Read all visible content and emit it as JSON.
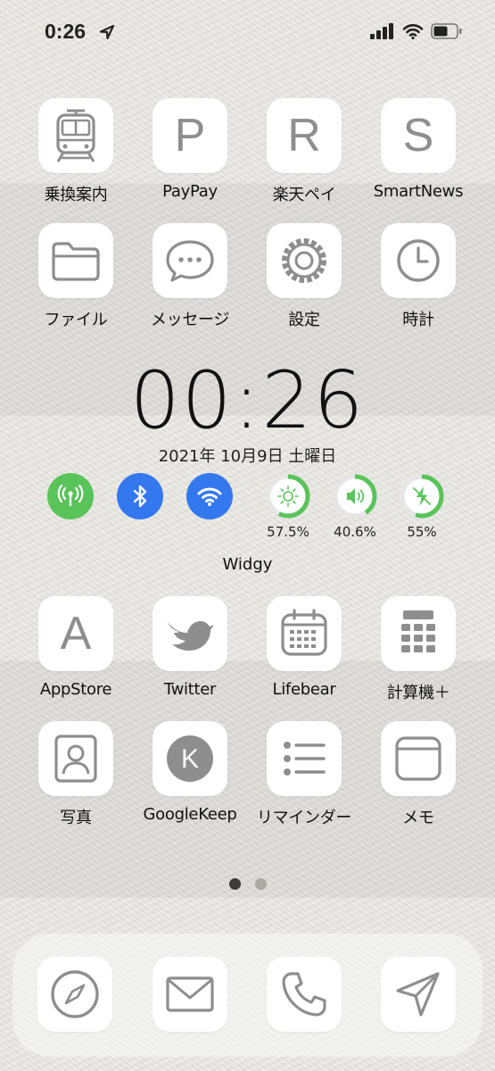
{
  "status": {
    "time": "0:26"
  },
  "apps": [
    {
      "name": "app-norikae",
      "label": "乗換案内",
      "icon": "train-icon"
    },
    {
      "name": "app-paypay",
      "label": "PayPay",
      "icon": "P"
    },
    {
      "name": "app-rakutenpay",
      "label": "楽天ペイ",
      "icon": "R"
    },
    {
      "name": "app-smartnews",
      "label": "SmartNews",
      "icon": "S"
    },
    {
      "name": "app-files",
      "label": "ファイル",
      "icon": "folder-icon"
    },
    {
      "name": "app-messages",
      "label": "メッセージ",
      "icon": "message-bubble-icon"
    },
    {
      "name": "app-settings",
      "label": "設定",
      "icon": "gear-icon"
    },
    {
      "name": "app-clock",
      "label": "時計",
      "icon": "clock-icon"
    },
    {
      "name": "app-appstore",
      "label": "AppStore",
      "icon": "A"
    },
    {
      "name": "app-twitter",
      "label": "Twitter",
      "icon": "bird-icon"
    },
    {
      "name": "app-lifebear",
      "label": "Lifebear",
      "icon": "calendar-icon"
    },
    {
      "name": "app-calculator",
      "label": "計算機＋",
      "icon": "calculator-icon"
    },
    {
      "name": "app-photos",
      "label": "写真",
      "icon": "portrait-icon"
    },
    {
      "name": "app-googlekeep",
      "label": "GoogleKeep",
      "icon": "k-circle-icon"
    },
    {
      "name": "app-reminders",
      "label": "リマインダー",
      "icon": "list-icon"
    },
    {
      "name": "app-notes",
      "label": "メモ",
      "icon": "notes-icon"
    }
  ],
  "widget": {
    "time": "00:26",
    "date": "2021年 10月9日 土曜日",
    "brightness": {
      "label": "57.5%",
      "fraction": 0.575
    },
    "volume": {
      "label": "40.6%",
      "fraction": 0.406
    },
    "battery": {
      "label": "55%",
      "fraction": 0.55
    },
    "name": "Widgy"
  },
  "pages": {
    "count": 2,
    "current": 1
  },
  "dock": [
    "compass-icon",
    "mail-icon",
    "phone-icon",
    "send-icon"
  ],
  "colors": {
    "green": "#5ac35a",
    "blue": "#3478f0",
    "icon_gray": "#8e8e8e",
    "ring_green": "#5ac35a"
  }
}
